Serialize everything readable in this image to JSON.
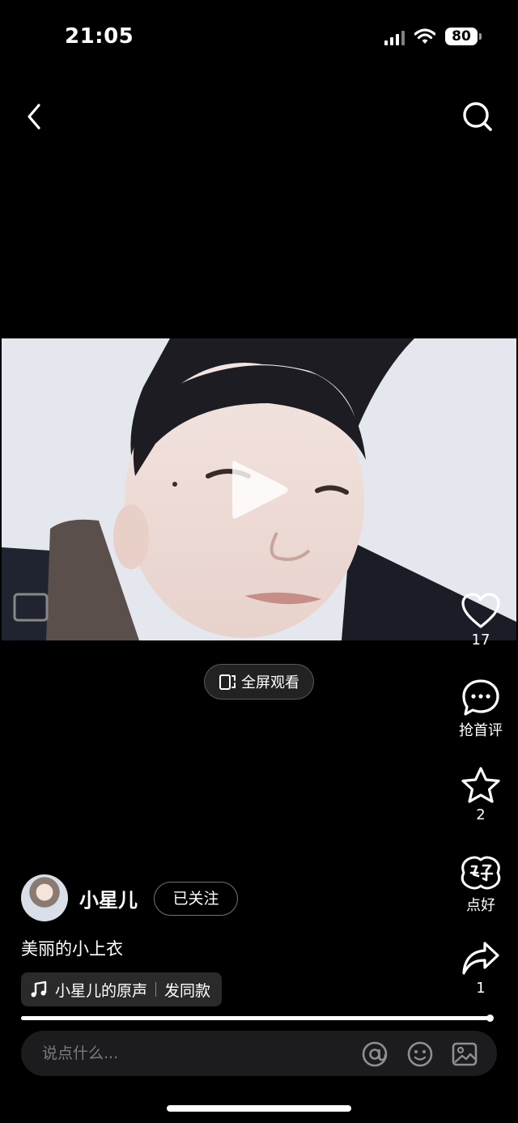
{
  "status": {
    "time": "21:05",
    "battery": "80"
  },
  "video": {
    "progress_fraction": 0.995
  },
  "fullscreen": {
    "label": "全屏观看"
  },
  "rail": {
    "like_count": "17",
    "comment_label": "抢首评",
    "favorite_count": "2",
    "good_label": "点好",
    "share_count": "1"
  },
  "author": {
    "name": "小星儿",
    "follow_label": "已关注"
  },
  "post": {
    "caption": "美丽的小上衣"
  },
  "music": {
    "title": "小星儿的原声",
    "action": "发同款"
  },
  "comment": {
    "placeholder": "说点什么..."
  },
  "icons": [
    "back-icon",
    "search-icon",
    "play-icon",
    "fullscreen-icon",
    "heart-icon",
    "comment-icon",
    "star-icon",
    "good-icon",
    "share-icon",
    "music-note-icon",
    "at-icon",
    "emoji-icon",
    "image-icon"
  ]
}
